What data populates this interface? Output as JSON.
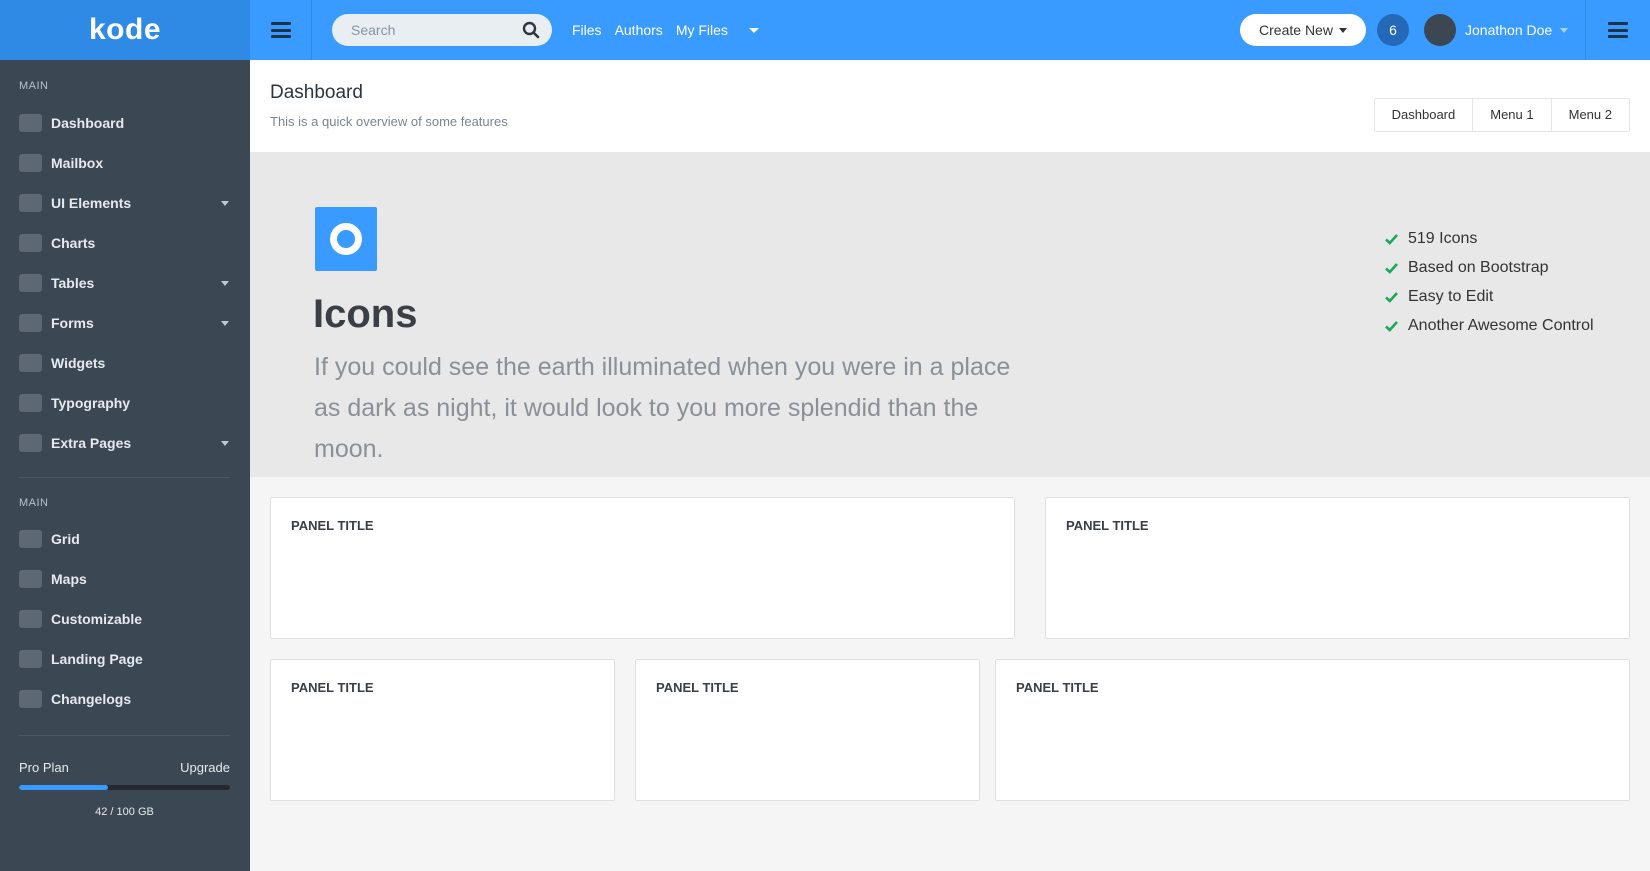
{
  "brand": "kode",
  "search": {
    "placeholder": "Search"
  },
  "top_nav": [
    "Files",
    "Authors",
    "My Files"
  ],
  "create_new": "Create New",
  "notifications": "6",
  "user": {
    "name": "Jonathon Doe"
  },
  "sidebar": {
    "sections": [
      {
        "label": "MAIN",
        "items": [
          {
            "label": "Dashboard",
            "has_submenu": false
          },
          {
            "label": "Mailbox",
            "has_submenu": false
          },
          {
            "label": "UI Elements",
            "has_submenu": true
          },
          {
            "label": "Charts",
            "has_submenu": false
          },
          {
            "label": "Tables",
            "has_submenu": true
          },
          {
            "label": "Forms",
            "has_submenu": true
          },
          {
            "label": "Widgets",
            "has_submenu": false
          },
          {
            "label": "Typography",
            "has_submenu": false
          },
          {
            "label": "Extra Pages",
            "has_submenu": true
          }
        ]
      },
      {
        "label": "MAIN",
        "items": [
          {
            "label": "Grid",
            "has_submenu": false
          },
          {
            "label": "Maps",
            "has_submenu": false
          },
          {
            "label": "Customizable",
            "has_submenu": false
          },
          {
            "label": "Landing Page",
            "has_submenu": false
          },
          {
            "label": "Changelogs",
            "has_submenu": false
          }
        ]
      }
    ],
    "plan": {
      "label": "Pro Plan",
      "upgrade": "Upgrade",
      "used_fraction": 0.42,
      "storage": "42 / 100 GB"
    }
  },
  "page": {
    "title": "Dashboard",
    "subtitle": "This is a quick overview of some features",
    "tabs": [
      "Dashboard",
      "Menu 1",
      "Menu 2"
    ]
  },
  "hero": {
    "icon": "circle-icon",
    "title": "Icons",
    "text": "If you could see the earth illuminated when you were in a place as dark as night, it would look to you more splendid than the moon.",
    "features": [
      "519 Icons",
      "Based on Bootstrap",
      "Easy to Edit",
      "Another Awesome Control"
    ]
  },
  "panels": [
    "PANEL TITLE",
    "PANEL TITLE",
    "PANEL TITLE",
    "PANEL TITLE",
    "PANEL TITLE"
  ],
  "colors": {
    "primary": "#399bff",
    "brand_bg": "#2f8ae5",
    "sidebar_bg": "#3b4752",
    "check": "#1aaa55",
    "notification_bg": "#2369b7"
  }
}
